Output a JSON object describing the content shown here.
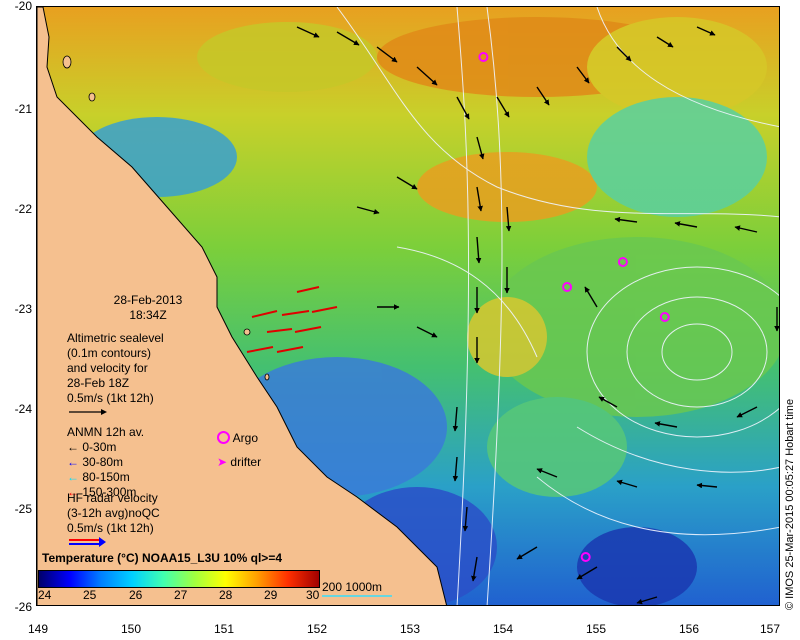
{
  "map": {
    "lon_range": [
      149,
      157
    ],
    "lat_range": [
      -26,
      -20
    ],
    "x_ticks": [
      "149",
      "150",
      "151",
      "152",
      "153",
      "154",
      "155",
      "156",
      "157"
    ],
    "y_ticks": [
      "-20",
      "-21",
      "-22",
      "-23",
      "-24",
      "-25",
      "-26"
    ],
    "colors": {
      "land": "#f5c08f",
      "contour": "#e8f0ff",
      "argo": "#ff00ff",
      "depth_0_30": "#000000",
      "depth_30_80": "#0000ff",
      "depth_80_150": "#00e0ff",
      "depth_150_300": "#ff0000"
    }
  },
  "info": {
    "date": "28-Feb-2013",
    "time": "18:34Z",
    "altimetry_lines": [
      "Altimetric sealevel",
      "(0.1m contours)",
      "and velocity for",
      "28-Feb 18Z",
      "0.5m/s (1kt 12h)"
    ]
  },
  "anmn": {
    "title": "ANMN 12h av.",
    "items": [
      "0-30m",
      "30-80m",
      "80-150m",
      "150-300m"
    ]
  },
  "argo_label": "Argo",
  "drifter_label": "drifter",
  "hf_radar": {
    "lines": [
      "HF radar velocity",
      "(3-12h avg)noQC",
      "0.5m/s (1kt 12h)"
    ]
  },
  "colorbar": {
    "title_bold": "Temperature",
    "title_rest": " (°C) NOAA15_L3U 10% ql>=4",
    "ticks": [
      "24",
      "25",
      "26",
      "27",
      "28",
      "29",
      "30"
    ]
  },
  "bathy_label": "200  1000m",
  "credit": "© IMOS 25-Mar-2015 00:05:27 Hobart time",
  "argo_floats": [
    {
      "lon": 153.8,
      "lat": -20.5
    },
    {
      "lon": 155.3,
      "lat": -22.55
    },
    {
      "lon": 154.7,
      "lat": -22.8
    },
    {
      "lon": 155.75,
      "lat": -23.1
    },
    {
      "lon": 154.9,
      "lat": -25.5
    }
  ]
}
